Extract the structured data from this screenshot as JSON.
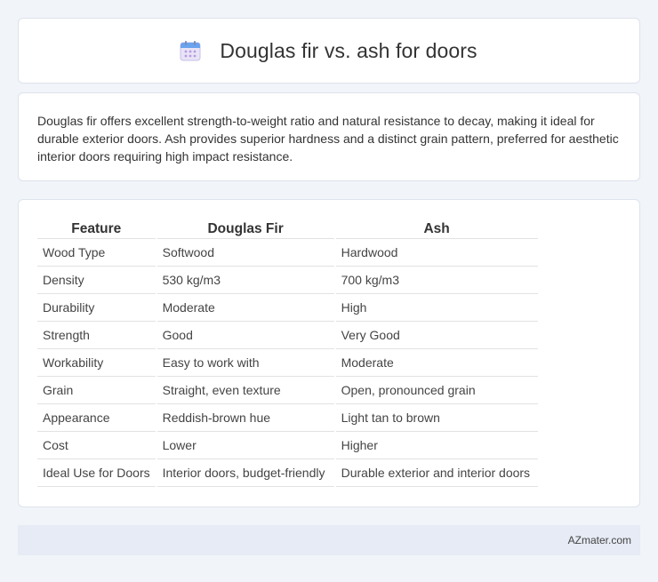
{
  "header": {
    "title": "Douglas fir vs. ash for doors",
    "icon": "calendar-icon"
  },
  "summary": {
    "text": "Douglas fir offers excellent strength-to-weight ratio and natural resistance to decay, making it ideal for durable exterior doors. Ash provides superior hardness and a distinct grain pattern, preferred for aesthetic interior doors requiring high impact resistance."
  },
  "table": {
    "headers": [
      "Feature",
      "Douglas Fir",
      "Ash"
    ],
    "rows": [
      [
        "Wood Type",
        "Softwood",
        "Hardwood"
      ],
      [
        "Density",
        "530 kg/m3",
        "700 kg/m3"
      ],
      [
        "Durability",
        "Moderate",
        "High"
      ],
      [
        "Strength",
        "Good",
        "Very Good"
      ],
      [
        "Workability",
        "Easy to work with",
        "Moderate"
      ],
      [
        "Grain",
        "Straight, even texture",
        "Open, pronounced grain"
      ],
      [
        "Appearance",
        "Reddish-brown hue",
        "Light tan to brown"
      ],
      [
        "Cost",
        "Lower",
        "Higher"
      ],
      [
        "Ideal Use for Doors",
        "Interior doors, budget-friendly",
        "Durable exterior and interior doors"
      ]
    ]
  },
  "footer": {
    "text": "AZmater.com"
  }
}
